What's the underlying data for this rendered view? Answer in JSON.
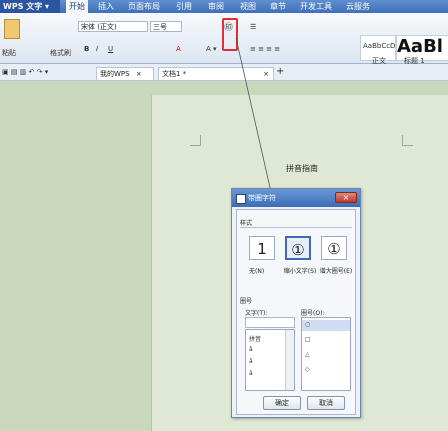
{
  "app": {
    "name": "WPS 文字"
  },
  "menu": [
    "开始",
    "插入",
    "页面布局",
    "引用",
    "审阅",
    "视图",
    "章节",
    "开发工具",
    "云服务"
  ],
  "ribbon": {
    "font_name": "宋体 (正文)",
    "font_size": "三号",
    "paste_label": "粘贴",
    "format_painter": "格式刷",
    "style_preview_small": "AaBbCcDc",
    "style_preview_large": "AaBl",
    "style_label_1": "正文",
    "style_label_2": "标题 1"
  },
  "tabs": {
    "tab1": "我的WPS",
    "tab2": "文档1 *",
    "new_tab": "+"
  },
  "document": {
    "text": "拼音指南"
  },
  "dialog": {
    "title": "带圈字符",
    "style_label": "样式",
    "styles": [
      {
        "glyph": "1",
        "label": "无(N)"
      },
      {
        "glyph": "①",
        "label": "缩小文字(S)"
      },
      {
        "glyph": "①",
        "label": "增大圈号(E)"
      }
    ],
    "circle_label": "圈号",
    "text_label": "文字(T):",
    "shape_label": "圈号(O):",
    "text_items": [
      "拼音",
      "â",
      "ǎ",
      "ā"
    ],
    "shape_items": [
      "○",
      "□",
      "△",
      "◇"
    ],
    "ok": "确定",
    "cancel": "取消"
  }
}
